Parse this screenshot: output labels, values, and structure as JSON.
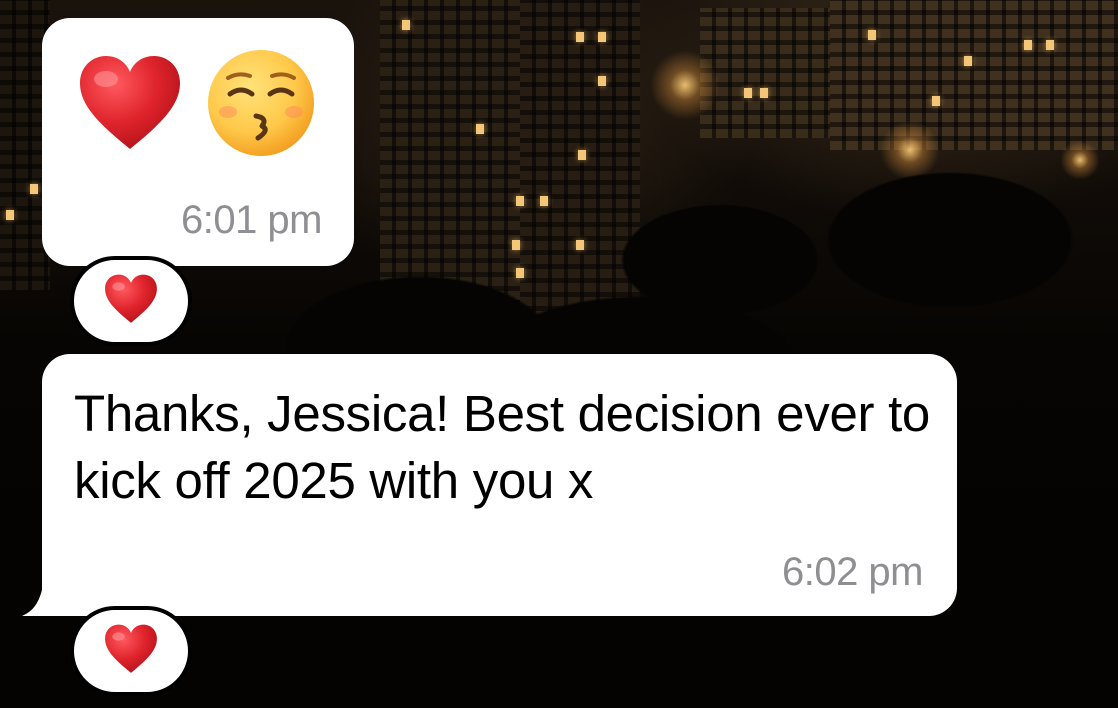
{
  "conversation": {
    "messages": [
      {
        "type": "emoji",
        "emojis": [
          "red-heart",
          "kissing-face-with-closed-eyes"
        ],
        "time": "6:01 pm",
        "reaction": "red-heart"
      },
      {
        "type": "text",
        "text": "Thanks, Jessica! Best decision ever to kick off 2025 with you x",
        "time": "6:02 pm",
        "reaction": "red-heart"
      }
    ]
  },
  "colors": {
    "bubble": "#ffffff",
    "text": "#000000",
    "timestamp": "#8e8e93",
    "heart": "#e0242c",
    "emoji_face": "#ffc94a"
  }
}
